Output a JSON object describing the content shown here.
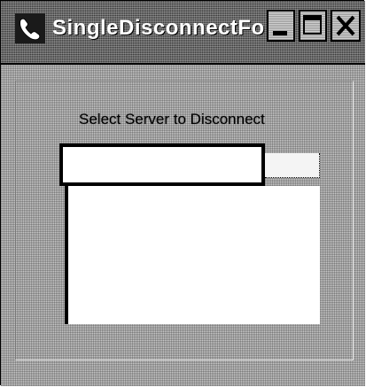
{
  "window": {
    "title": "SingleDisconnectFo...",
    "icon": "telephone-handset-icon"
  },
  "titlebar_buttons": {
    "minimize_icon": "minimize-icon",
    "maximize_icon": "maximize-icon",
    "close_icon": "close-icon"
  },
  "form": {
    "caption": "Select Server to Disconnect",
    "server_input": {
      "value": "",
      "placeholder": ""
    },
    "server_list": {
      "items": []
    }
  }
}
